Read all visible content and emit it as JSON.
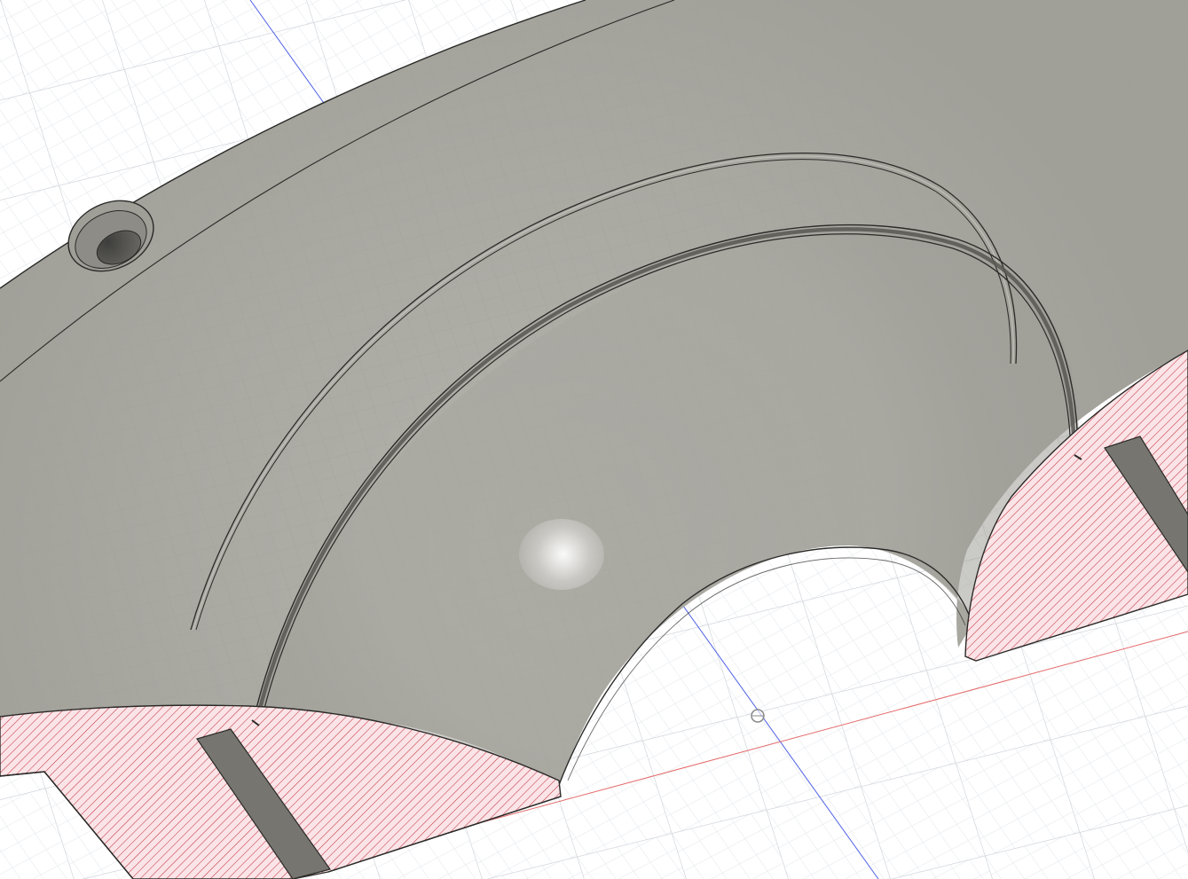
{
  "viewport": {
    "colors": {
      "background": "#ffffff",
      "grid_minor": "#dfe3e8",
      "grid_major": "#c7ccd3",
      "body_face": "#a9a8a1",
      "body_edge": "#2a2a28",
      "section_fill": "#fbe3e6",
      "section_hatch": "#c33a44",
      "axis_blue": "#4c5be0",
      "axis_red": "#e06464"
    },
    "icons": {
      "origin": "origin-point-icon"
    }
  }
}
